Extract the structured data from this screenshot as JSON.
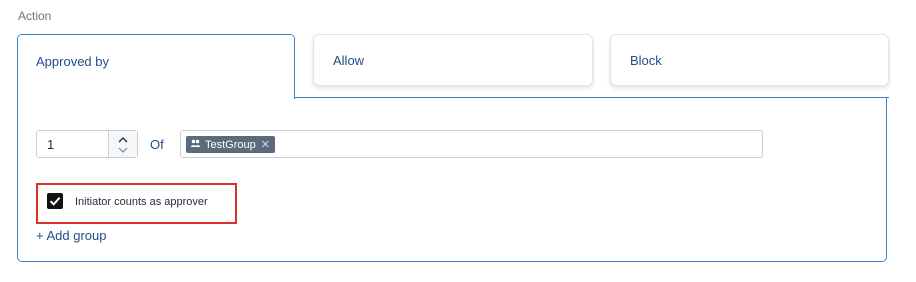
{
  "section": {
    "label": "Action"
  },
  "tabs": [
    {
      "label": "Approved by",
      "active": true
    },
    {
      "label": "Allow",
      "active": false
    },
    {
      "label": "Block",
      "active": false
    }
  ],
  "approvers": {
    "count_value": "1",
    "of_label": "Of",
    "groups": [
      {
        "label": "TestGroup",
        "icon": "group-icon",
        "remove_glyph": "✕"
      }
    ]
  },
  "initiator_checkbox": {
    "label": "Initiator counts as approver",
    "checked": true
  },
  "add_group_link": {
    "label": "+ Add group"
  },
  "colors": {
    "accent_blue": "#3f82c6",
    "link_blue": "#1f4f86",
    "tag_bg": "#5c6b7c",
    "highlight_red": "#d9312b",
    "checkbox_fill": "#111111"
  }
}
